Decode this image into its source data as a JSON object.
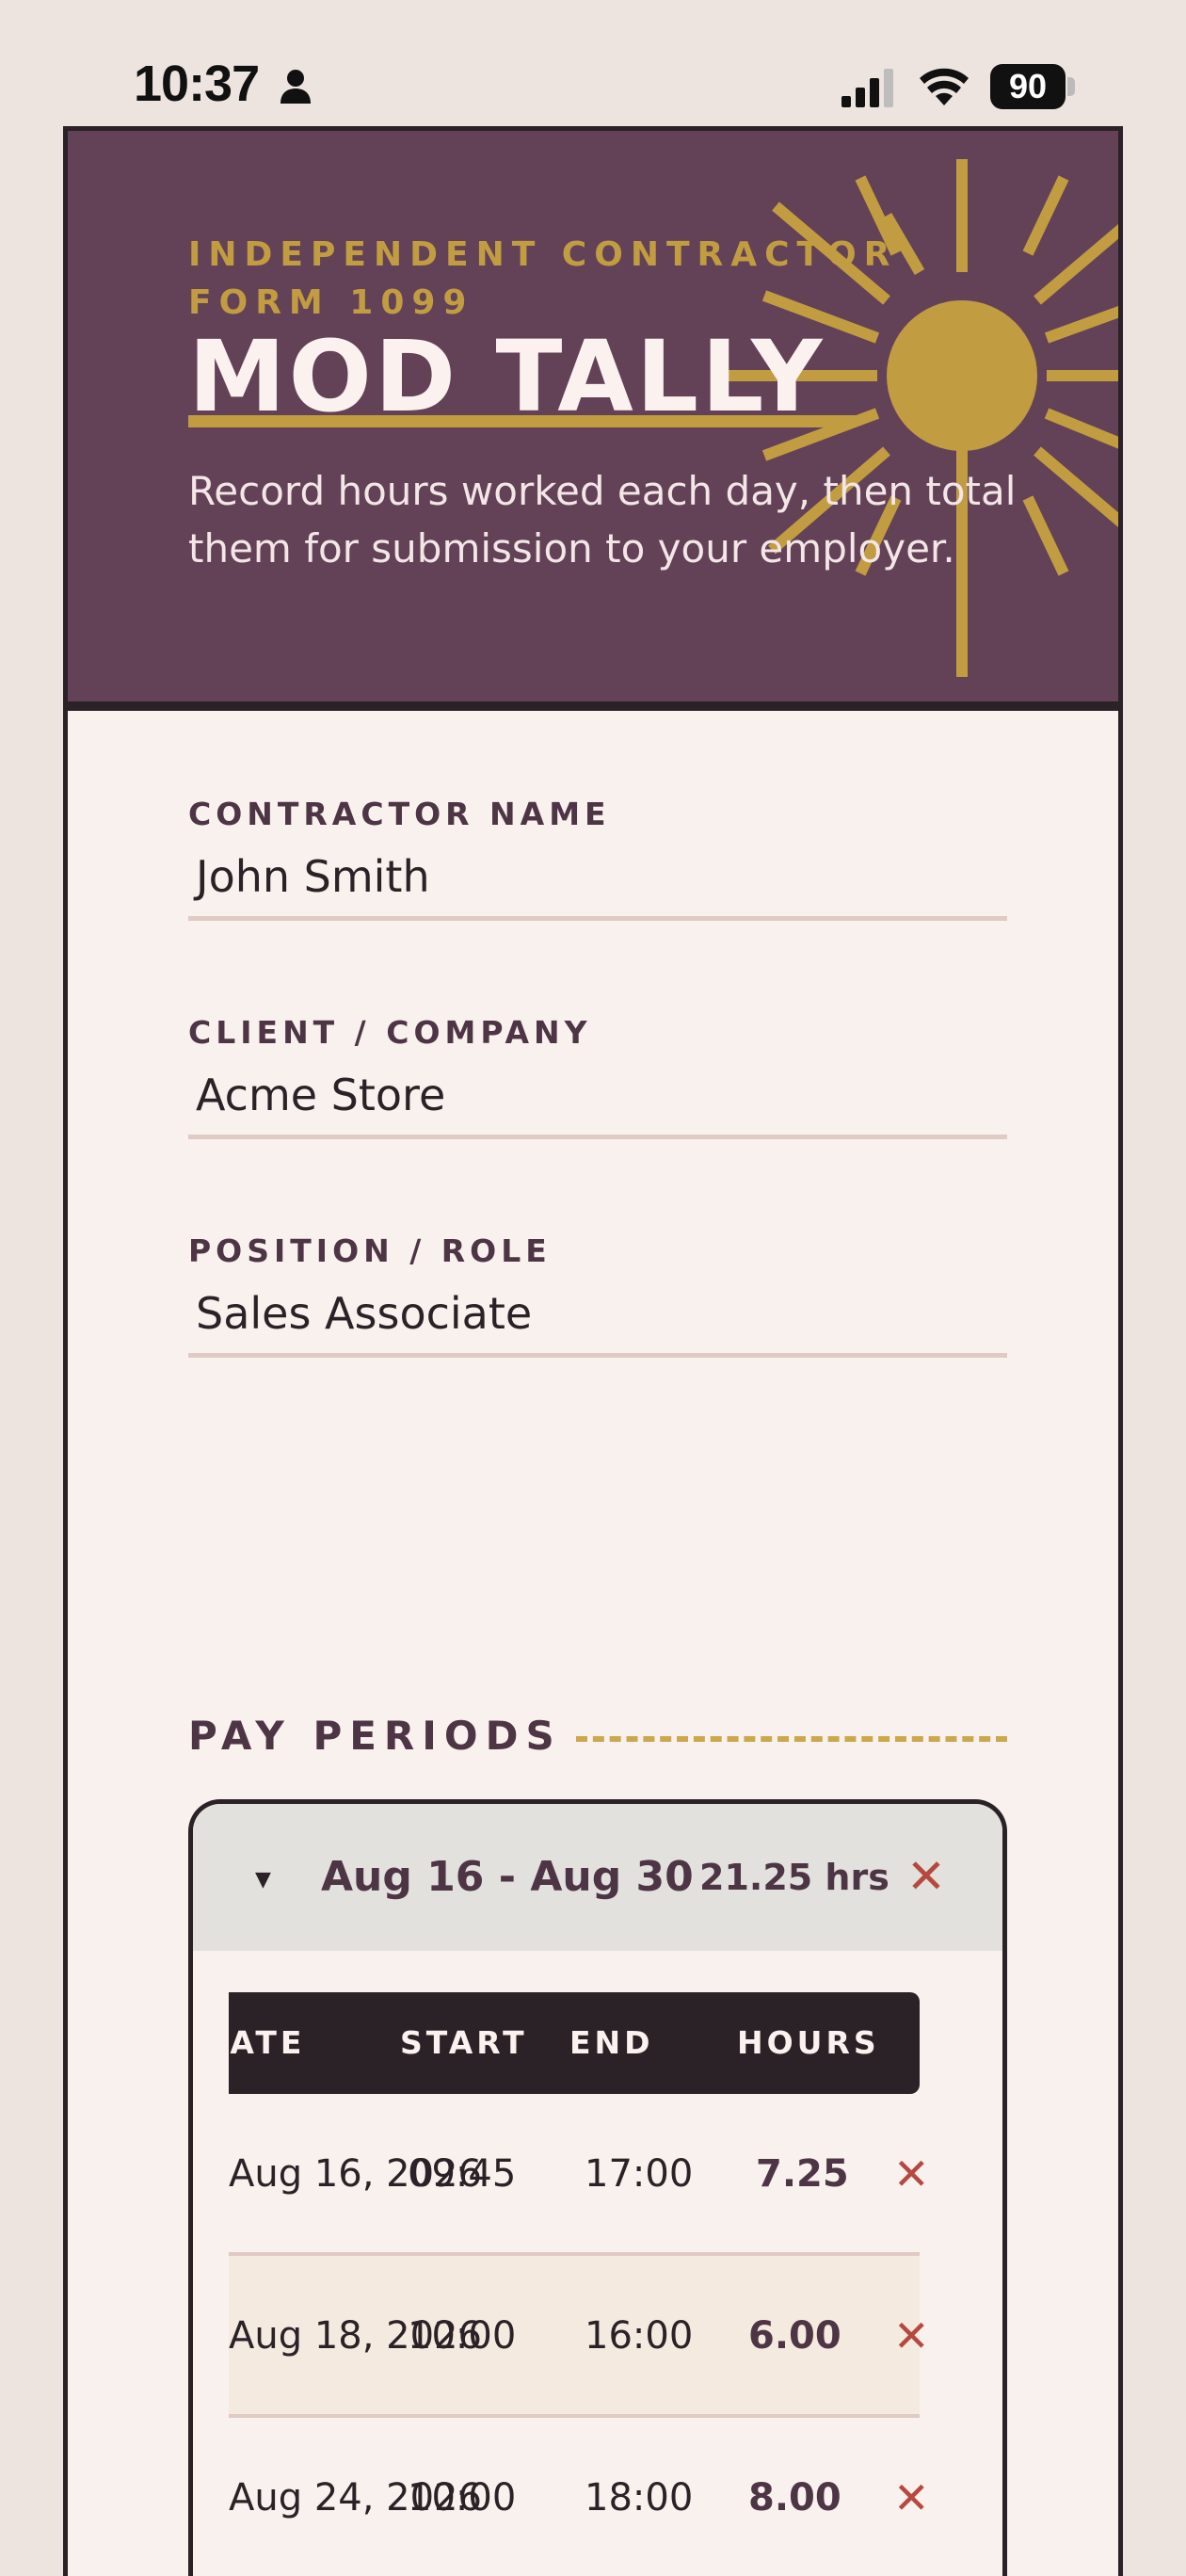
{
  "status_bar": {
    "time": "10:37",
    "battery": "90",
    "icons": [
      "person-icon",
      "cellular-signal-icon",
      "wifi-icon",
      "battery-icon"
    ]
  },
  "header": {
    "kicker": "INDEPENDENT CONTRACTOR FORM 1099",
    "title": "MOD TALLY",
    "description": "Record hours worked each day, then total them for submission to your employer.",
    "icons": [
      "sun-icon"
    ]
  },
  "form": {
    "contractor": {
      "label": "CONTRACTOR NAME",
      "value": "John Smith"
    },
    "client": {
      "label": "CLIENT / COMPANY",
      "value": "Acme Store"
    },
    "position": {
      "label": "POSITION / ROLE",
      "value": "Sales Associate"
    }
  },
  "pay_periods": {
    "title": "PAY PERIODS",
    "periods": [
      {
        "range": "Aug 16 - Aug 30",
        "total": "21.25 hrs",
        "columns": {
          "date": "DATE",
          "start": "START",
          "end": "END",
          "hours": "HOURS"
        },
        "rows": [
          {
            "date": "Aug 16, 2026",
            "start": "09:45",
            "end": "17:00",
            "hours": "7.25"
          },
          {
            "date": "Aug 18, 2026",
            "start": "10:00",
            "end": "16:00",
            "hours": "6.00"
          },
          {
            "date": "Aug 24, 2026",
            "start": "10:00",
            "end": "18:00",
            "hours": "8.00"
          }
        ]
      }
    ]
  },
  "colors": {
    "hero_background": "#634257",
    "accent_gold": "#c29c41",
    "ink": "#2b2228",
    "remove_red": "#b5493f",
    "paper": "#f9f1ee"
  }
}
